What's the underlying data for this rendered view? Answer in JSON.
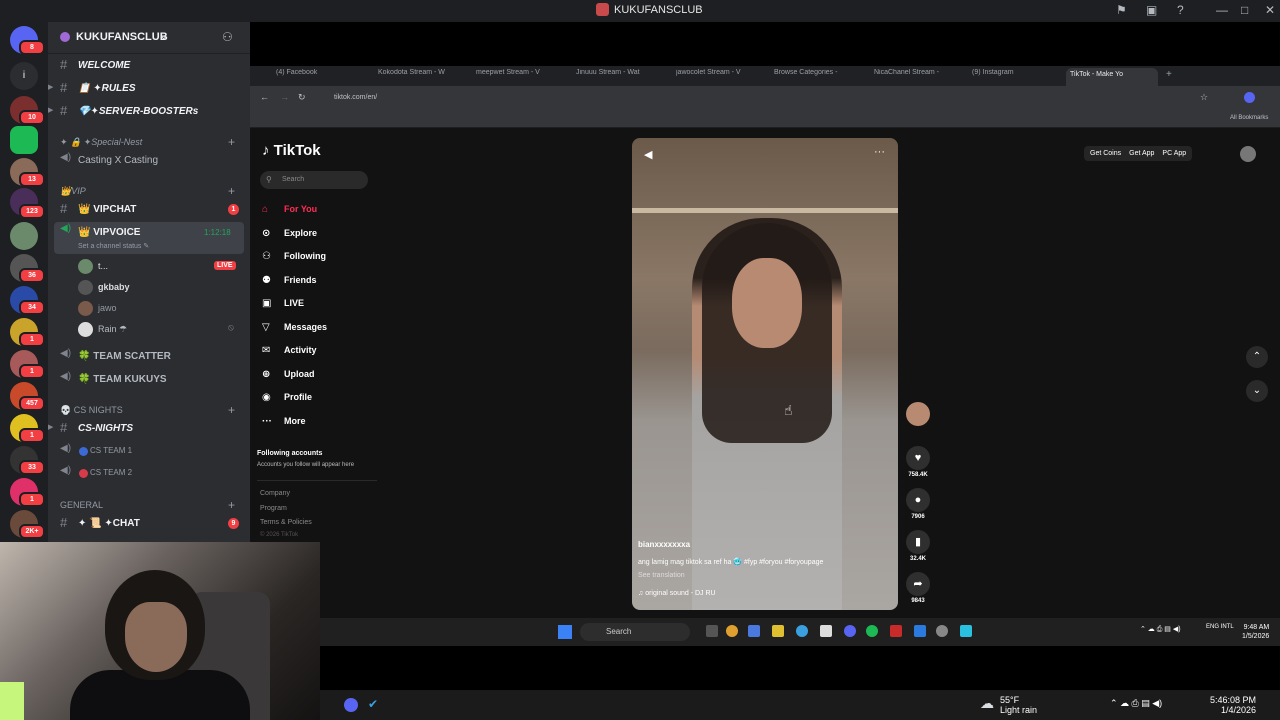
{
  "window": {
    "title": "KUKUFANSCLUB"
  },
  "rail": {
    "badges": [
      "8",
      "10",
      "13",
      "123",
      "36",
      "34",
      "1",
      "1",
      "457",
      "1",
      "33",
      "1",
      "2K+"
    ]
  },
  "sidebar": {
    "server_name": "KUKUFANSCLUB",
    "channels_top": [
      {
        "name": "WELCOME"
      },
      {
        "name": "📋 ✦RULES"
      },
      {
        "name": "💎✦SERVER-BOOSTERs"
      }
    ],
    "cat_special": "✦ 🔒 ✦Special-Nest",
    "casting": "Casting X Casting",
    "cat_vip": "👑VIP",
    "vipchat": "👑 VIPCHAT",
    "vipchat_badge": "1",
    "vipvoice": "👑 VIPVOICE",
    "vipvoice_time": "1:12:18",
    "vipvoice_status": "Set a channel status ✎",
    "users": [
      {
        "name": "t..."
      },
      {
        "name": "gkbaby"
      },
      {
        "name": "jawo"
      },
      {
        "name": "Rain ☂"
      }
    ],
    "live_label": "LIVE",
    "team_scatter": "🍀 TEAM SCATTER",
    "team_kukuys": "🍀 TEAM KUKUYS",
    "cat_cs": "💀 CS NIGHTS",
    "cs_nights": "CS-NIGHTS",
    "cs_team1": "CS TEAM 1",
    "cs_team2": "CS TEAM 2",
    "cat_general": "GENERAL",
    "chat": "✦ 📜 ✦CHAT",
    "chat_badge": "9"
  },
  "browser": {
    "tabs": [
      "(4) Facebook",
      "Kokodota Stream - W",
      "meepwet Stream - V",
      "Jinuuu Stream - Wat",
      "jawocolet Stream - V",
      "Browse Categories -",
      "NicaChanel Stream -",
      "(9) Instagram",
      "TikTok - Make Yo"
    ],
    "url": "tiktok.com/en/",
    "all_bookmarks": "All Bookmarks"
  },
  "tiktok": {
    "logo": "TikTok",
    "search_placeholder": "Search",
    "nav": [
      "For You",
      "Explore",
      "Following",
      "Friends",
      "LIVE",
      "Messages",
      "Activity",
      "Upload",
      "Profile",
      "More"
    ],
    "nav_icons": [
      "⌂",
      "⊙",
      "⚇",
      "⚉",
      "▣",
      "▽",
      "✉",
      "⊕",
      "◉",
      "···"
    ],
    "following_accounts": "Following accounts",
    "following_sub": "Accounts you follow will appear here",
    "footer": [
      "Company",
      "Program",
      "Terms & Policies",
      "© 2026 TikTok"
    ],
    "top_buttons": [
      "Get Coins",
      "Get App",
      "PC App"
    ],
    "video": {
      "username": "bianxxxxxxxa",
      "caption": "ang lamig mag tiktok sa ref ha 🥶 #fyp #foryou #foryoupage",
      "see_translation": "See translation",
      "sound": "♫  original sound - DJ RU"
    },
    "actions": [
      "758.4K",
      "7906",
      "32.4K",
      "9843"
    ]
  },
  "wintaskbar": {
    "search": "Search",
    "tray": "ENG INTL",
    "time": "9:48 AM",
    "date": "1/5/2026"
  },
  "bottombar": {
    "temp": "55°F",
    "weather": "Light rain",
    "time": "5:46:08 PM",
    "date": "1/4/2026"
  }
}
